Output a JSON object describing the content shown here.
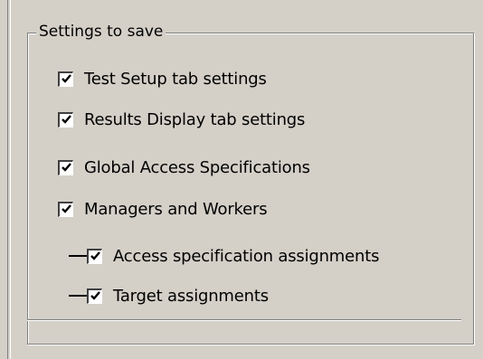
{
  "group": {
    "title": "Settings to save"
  },
  "options": [
    {
      "label": "Test Setup tab settings",
      "checked": true
    },
    {
      "label": "Results Display tab settings",
      "checked": true
    },
    {
      "label": "Global Access Specifications",
      "checked": true
    },
    {
      "label": "Managers and Workers",
      "checked": true
    }
  ],
  "sub_options": [
    {
      "label": "Access specification assignments",
      "checked": true
    },
    {
      "label": "Target assignments",
      "checked": true
    }
  ]
}
